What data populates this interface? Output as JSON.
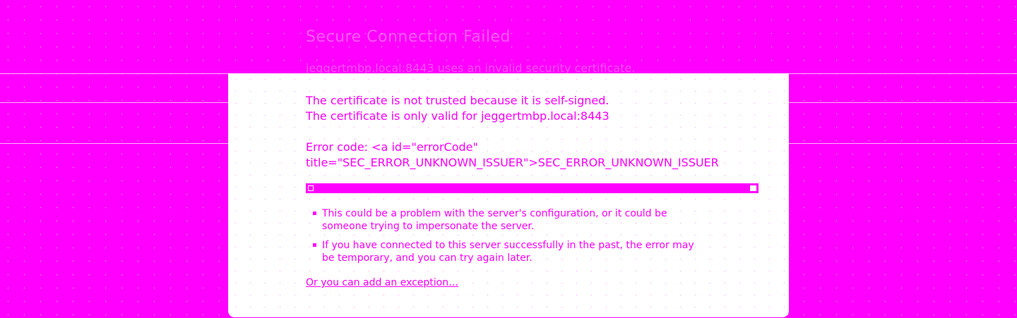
{
  "page": {
    "title": "Secure Connection Failed",
    "url_text": "jeggertmbp.local:8443 uses an invalid security certificate."
  },
  "error": {
    "line1": "The certificate is not trusted because it is self-signed.",
    "line2": "The certificate is only valid for jeggertmbp.local:8443",
    "code_line1": "Error code: <a id=\"errorCode\"",
    "code_line2": "title=\"SEC_ERROR_UNKNOWN_ISSUER\">SEC_ERROR_UNKNOWN_ISSUER"
  },
  "bullets": [
    {
      "line1": "This could be a problem with the server's configuration, or it could be",
      "line2": "someone trying to impersonate the server."
    },
    {
      "line1": "If you have connected to this server successfully in the past, the error may",
      "line2": "be temporary, and you can try again later."
    }
  ],
  "exception_link": "Or you can add an exception…",
  "colors": {
    "background": "#ff00ff",
    "card": "#ffffff",
    "text": "#ff00ff"
  }
}
